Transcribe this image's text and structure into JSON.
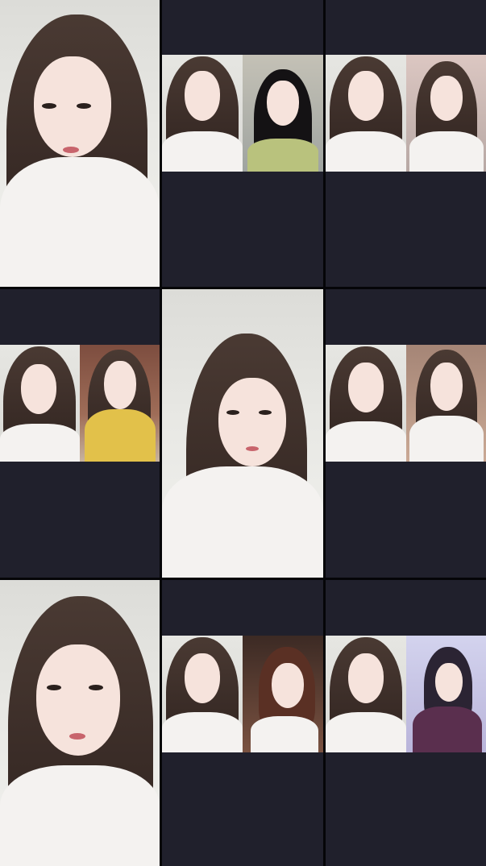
{
  "tiles": [
    {
      "layout": "full"
    },
    {
      "layout": "split"
    },
    {
      "layout": "split"
    },
    {
      "layout": "split"
    },
    {
      "layout": "full"
    },
    {
      "layout": "split"
    },
    {
      "layout": "full"
    },
    {
      "layout": "split"
    },
    {
      "layout": "split"
    }
  ],
  "colors": {
    "dark_panel": "#20202c",
    "divider": "#050508",
    "hair": "#3a2c27",
    "skin": "#f6e3dc",
    "shirt": "#f4f2f0"
  }
}
